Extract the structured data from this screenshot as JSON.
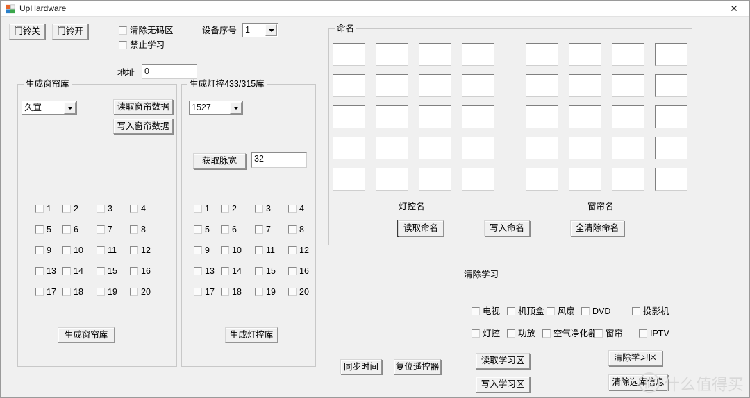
{
  "window": {
    "title": "UpHardware",
    "icon": "app-icon",
    "close_label": "✕"
  },
  "toolbar": {
    "doorbell_off": "门铃关",
    "doorbell_on": "门铃开",
    "checkboxes": [
      {
        "label": "清除无码区",
        "checked": false
      },
      {
        "label": "禁止学习",
        "checked": false
      }
    ],
    "device_no_label": "设备序号",
    "device_no_value": "1",
    "address_label": "地址",
    "address_value": "0"
  },
  "curtain_group": {
    "title": "生成窗帘库",
    "brand_value": "久宜",
    "read_button": "读取窗帘数据",
    "write_button": "写入窗帘数据",
    "checkboxes": [
      "1",
      "2",
      "3",
      "4",
      "5",
      "6",
      "7",
      "8",
      "9",
      "10",
      "11",
      "12",
      "13",
      "14",
      "15",
      "16",
      "17",
      "18",
      "19",
      "20"
    ],
    "generate_button": "生成窗帘库"
  },
  "light_group": {
    "title": "生成灯控433/315库",
    "chip_value": "1527",
    "pulse_button": "获取脉宽",
    "pulse_value": "32",
    "checkboxes": [
      "1",
      "2",
      "3",
      "4",
      "5",
      "6",
      "7",
      "8",
      "9",
      "10",
      "11",
      "12",
      "13",
      "14",
      "15",
      "16",
      "17",
      "18",
      "19",
      "20"
    ],
    "generate_button": "生成灯控库"
  },
  "naming_group": {
    "title": "命名",
    "left_caption": "灯控名",
    "right_caption": "窗帘名",
    "left_boxes": [
      "",
      "",
      "",
      "",
      "",
      "",
      "",
      "",
      "",
      "",
      "",
      "",
      "",
      "",
      "",
      "",
      "",
      "",
      "",
      ""
    ],
    "right_boxes": [
      "",
      "",
      "",
      "",
      "",
      "",
      "",
      "",
      "",
      "",
      "",
      "",
      "",
      "",
      "",
      "",
      "",
      "",
      "",
      ""
    ],
    "read_button": "读取命名",
    "write_button": "写入命名",
    "clear_all_button": "全清除命名"
  },
  "bottom_buttons": {
    "sync_time": "同步时间",
    "reset_remote": "复位遥控器"
  },
  "clear_learn_group": {
    "title": "清除学习",
    "row1": [
      {
        "label": "电视",
        "checked": false
      },
      {
        "label": "机顶盒",
        "checked": false
      },
      {
        "label": "风扇",
        "checked": false
      },
      {
        "label": "DVD",
        "checked": false
      },
      {
        "label": "投影机",
        "checked": false
      }
    ],
    "row2": [
      {
        "label": "灯控",
        "checked": false
      },
      {
        "label": "功放",
        "checked": false
      },
      {
        "label": "空气净化器",
        "checked": false
      },
      {
        "label": "窗帘",
        "checked": false
      },
      {
        "label": "IPTV",
        "checked": false
      }
    ],
    "read_button": "读取学习区",
    "write_button": "写入学习区",
    "clear_button": "清除学习区",
    "clear_lib_button": "清除选库信息"
  },
  "watermark": {
    "mark": "值",
    "text": "什么值得买"
  },
  "colors": {
    "window_bg": "#f0f0f0",
    "titlebar_bg": "#ffffff",
    "border": "#c8c8c8",
    "field_bg": "#ffffff"
  }
}
